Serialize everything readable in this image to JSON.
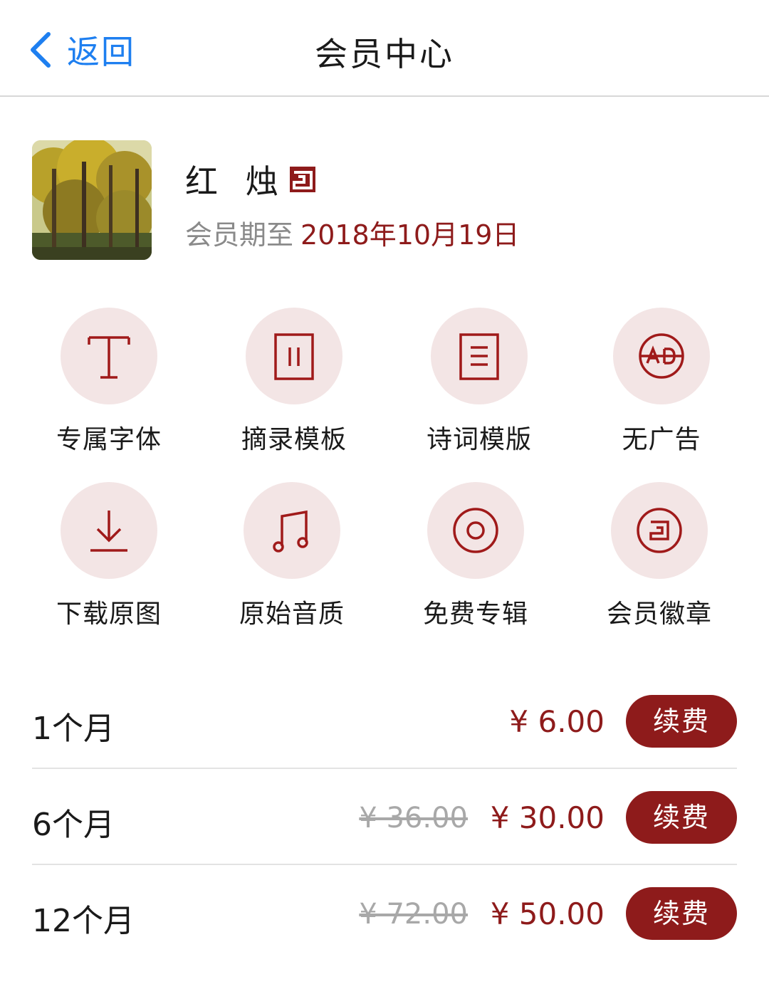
{
  "nav": {
    "back_label": "返回",
    "title": "会员中心"
  },
  "profile": {
    "username": "红 烛",
    "expire_label": "会员期至",
    "expire_date": "2018年10月19日"
  },
  "features": [
    {
      "label": "专属字体",
      "icon": "font-icon"
    },
    {
      "label": "摘录模板",
      "icon": "excerpt-template-icon"
    },
    {
      "label": "诗词模版",
      "icon": "poem-template-icon"
    },
    {
      "label": "无广告",
      "icon": "no-ad-icon"
    },
    {
      "label": "下载原图",
      "icon": "download-icon"
    },
    {
      "label": "原始音质",
      "icon": "music-note-icon"
    },
    {
      "label": "免费专辑",
      "icon": "album-disc-icon"
    },
    {
      "label": "会员徽章",
      "icon": "member-badge-icon"
    }
  ],
  "plans": [
    {
      "name": "1个月",
      "old_price": "",
      "price": "¥ 6.00",
      "button": "续费"
    },
    {
      "name": "6个月",
      "old_price": "¥ 36.00",
      "price": "¥ 30.00",
      "button": "续费"
    },
    {
      "name": "12个月",
      "old_price": "¥ 72.00",
      "price": "¥ 50.00",
      "button": "续费"
    }
  ],
  "colors": {
    "accent": "#8e1b1b",
    "link": "#1e7ff0",
    "icon_bg": "#f3e5e5",
    "divider": "#e3e3e3"
  }
}
